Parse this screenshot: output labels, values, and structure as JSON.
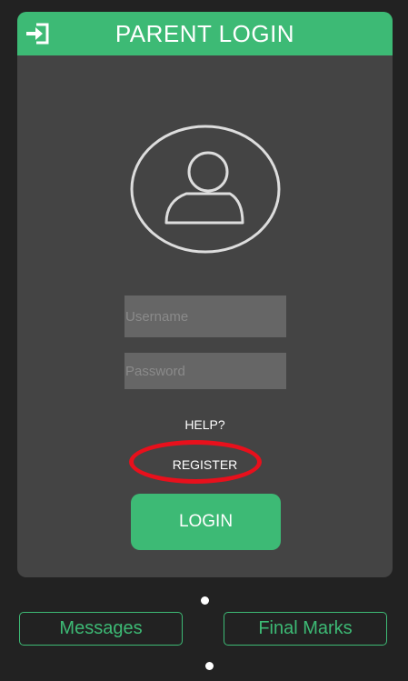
{
  "header": {
    "title": "PARENT LOGIN",
    "icon": "sign-in-icon"
  },
  "avatar": {
    "icon": "user-icon"
  },
  "form": {
    "username_placeholder": "Username",
    "username_value": "",
    "password_placeholder": "Password",
    "password_value": ""
  },
  "links": {
    "help": "HELP?",
    "register": "REGISTER"
  },
  "login_button": "LOGIN",
  "bottom_nav": {
    "messages": "Messages",
    "final_marks": "Final Marks"
  },
  "colors": {
    "accent": "#3dba75",
    "card": "#444444",
    "background": "#222222",
    "input": "#666666",
    "highlight": "#e8101c"
  }
}
